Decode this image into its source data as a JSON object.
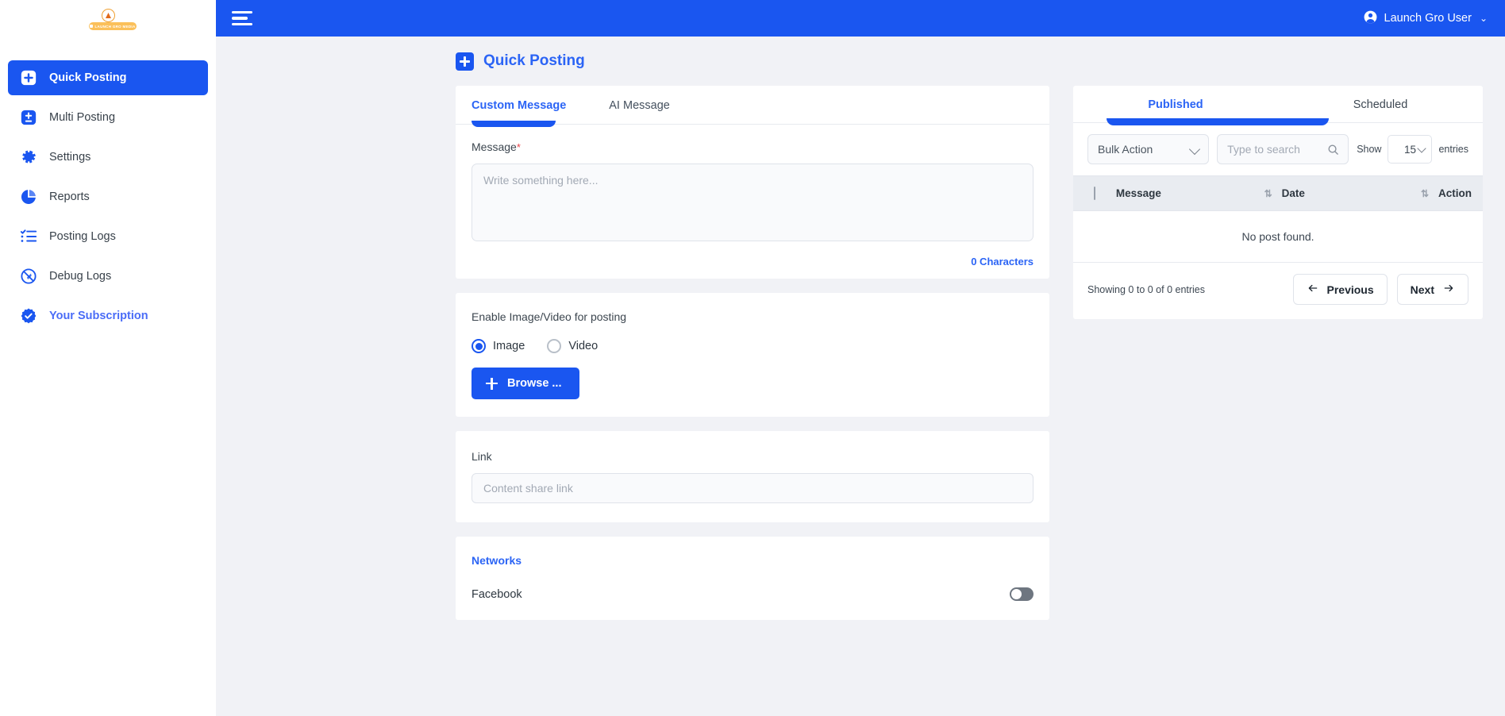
{
  "brand": {
    "badge_text": "LAUNCH  GRO  MEDIA",
    "accent": "#1a56f0",
    "logo_color": "#fbc05a"
  },
  "topbar": {
    "menu_icon": "hamburger-icon",
    "user_name": "Launch Gro User",
    "caret": "⌄"
  },
  "sidebar": {
    "items": [
      {
        "label": "Quick Posting",
        "icon": "plus-square-icon",
        "active": true
      },
      {
        "label": "Multi Posting",
        "icon": "plus-minus-icon",
        "active": false
      },
      {
        "label": "Settings",
        "icon": "gear-icon",
        "active": false
      },
      {
        "label": "Reports",
        "icon": "pie-chart-icon",
        "active": false
      },
      {
        "label": "Posting Logs",
        "icon": "checklist-icon",
        "active": false
      },
      {
        "label": "Debug Logs",
        "icon": "no-entry-icon",
        "active": false
      },
      {
        "label": "Your Subscription",
        "icon": "verified-badge-icon",
        "active": false
      }
    ]
  },
  "page": {
    "title": "Quick Posting",
    "icon": "plus-square-icon"
  },
  "compose": {
    "tabs": [
      {
        "label": "Custom Message",
        "active": true
      },
      {
        "label": "AI Message",
        "active": false
      }
    ],
    "message_label": "Message",
    "required_mark": "*",
    "message_value": "",
    "message_placeholder": "Write something here...",
    "char_count": "0 Characters"
  },
  "media": {
    "title": "Enable Image/Video for posting",
    "options": [
      {
        "label": "Image",
        "selected": true
      },
      {
        "label": "Video",
        "selected": false
      }
    ],
    "browse_label": "Browse ..."
  },
  "link": {
    "label": "Link",
    "value": "",
    "placeholder": "Content share link"
  },
  "networks": {
    "title": "Networks",
    "items": [
      {
        "label": "Facebook",
        "enabled": false
      }
    ]
  },
  "posts_panel": {
    "tabs": [
      {
        "label": "Published",
        "active": true
      },
      {
        "label": "Scheduled",
        "active": false
      }
    ],
    "bulk_action": {
      "value": "Bulk Action",
      "icon": "chevron-down-icon"
    },
    "search": {
      "value": "",
      "placeholder": "Type to search",
      "icon": "search-icon"
    },
    "show_label": "Show",
    "entries_label": "entries",
    "page_size": "15",
    "table": {
      "columns": [
        "Message",
        "Date",
        "Action"
      ],
      "rows": [],
      "empty_text": "No post found."
    },
    "footer": {
      "showing": "Showing 0 to 0 of 0 entries",
      "previous": "Previous",
      "next": "Next",
      "prev_icon": "arrow-left-icon",
      "next_icon": "arrow-right-icon"
    }
  }
}
